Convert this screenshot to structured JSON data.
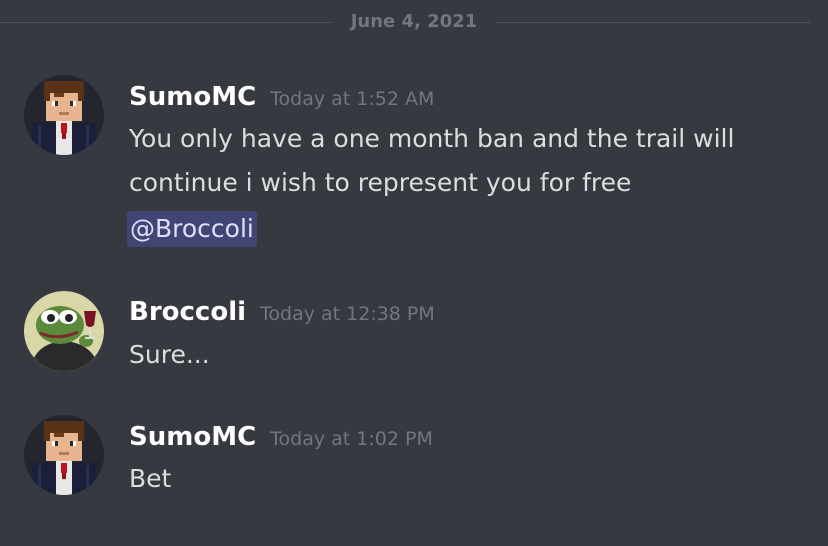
{
  "date_divider": "June 4, 2021",
  "messages": [
    {
      "username": "SumoMC",
      "timestamp": "Today at 1:52 AM",
      "text": "You only have a one month ban and the trail will continue i wish to represent you for free",
      "mention": "@Broccoli",
      "avatar": "minecraft-skin-avatar"
    },
    {
      "username": "Broccoli",
      "timestamp": "Today at 12:38 PM",
      "text": "Sure...",
      "avatar": "pepe-wine-avatar"
    },
    {
      "username": "SumoMC",
      "timestamp": "Today at 1:02 PM",
      "text": "Bet",
      "avatar": "minecraft-skin-avatar"
    }
  ],
  "colors": {
    "background": "#36393f",
    "username": "#ffffff",
    "timestamp": "#72767d",
    "message_text": "#dcddde",
    "mention_bg": "#5865f24d",
    "mention_text": "#dee0fc"
  }
}
